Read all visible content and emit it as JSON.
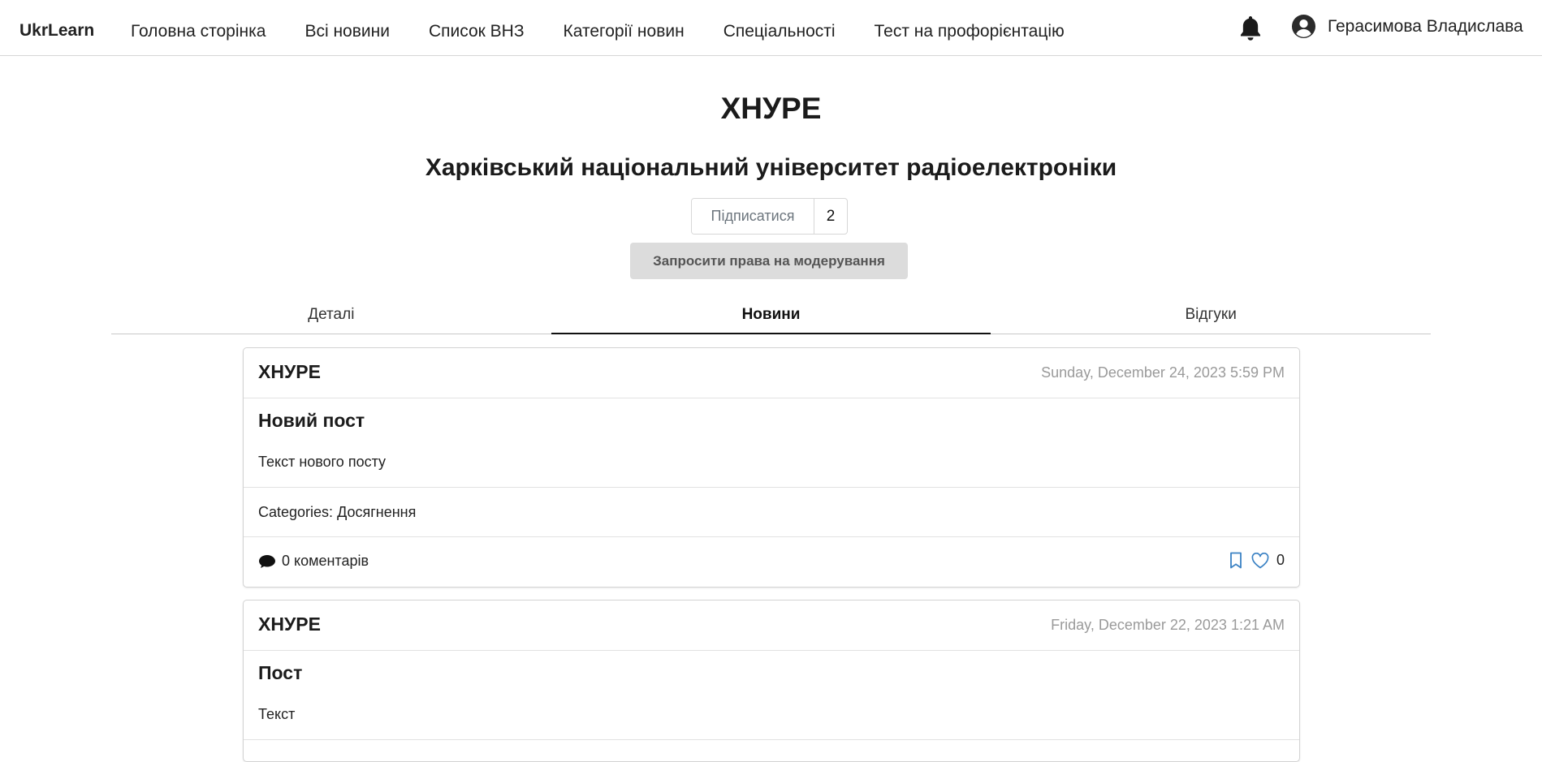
{
  "navbar": {
    "brand": "UkrLearn",
    "links": [
      "Головна сторінка",
      "Всі новини",
      "Список ВНЗ",
      "Категорії новин",
      "Спеціальності",
      "Тест на профорієнтацію"
    ],
    "user_name": "Герасимова Владислава"
  },
  "university": {
    "short_name": "ХНУРЕ",
    "full_name": "Харківський національний університет радіоелектроніки"
  },
  "subscribe": {
    "label": "Підписатися",
    "count": "2"
  },
  "moderation_button": "Запросити права на модерування",
  "tabs": [
    {
      "label": "Деталі",
      "active": false
    },
    {
      "label": "Новини",
      "active": true
    },
    {
      "label": "Відгуки",
      "active": false
    }
  ],
  "posts": [
    {
      "org": "ХНУРЕ",
      "date": "Sunday, December 24, 2023 5:59 PM",
      "title": "Новий пост",
      "text": "Текст нового посту",
      "categories_label": "Categories:",
      "categories": "Досягнення",
      "comments": "0 коментарів",
      "likes": "0"
    },
    {
      "org": "ХНУРЕ",
      "date": "Friday, December 22, 2023 1:21 AM",
      "title": "Пост",
      "text": "Текст"
    }
  ],
  "colors": {
    "accent_icon": "#3b82c4",
    "moderation_bg": "#dcdcdc",
    "muted_text": "#9a9a9a"
  },
  "icons": {
    "notifications": "bell-icon",
    "user": "user-circle-icon",
    "comments": "comment-icon",
    "bookmark": "bookmark-icon",
    "like": "heart-icon"
  }
}
